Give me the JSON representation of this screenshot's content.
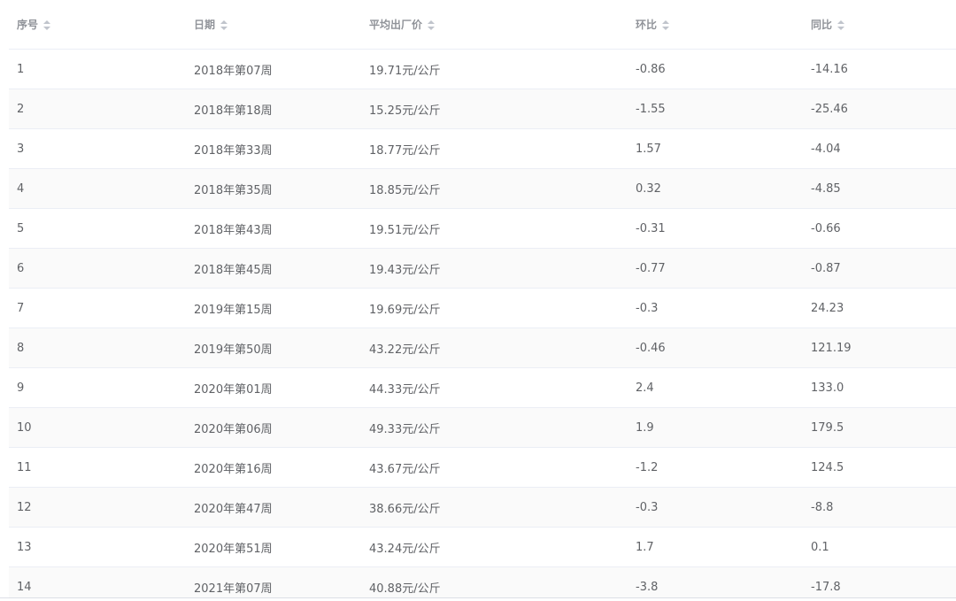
{
  "table": {
    "headers": [
      "序号",
      "日期",
      "平均出厂价",
      "环比",
      "同比"
    ],
    "rows": [
      [
        "1",
        "2018年第07周",
        "19.71元/公斤",
        "-0.86",
        "-14.16"
      ],
      [
        "2",
        "2018年第18周",
        "15.25元/公斤",
        "-1.55",
        "-25.46"
      ],
      [
        "3",
        "2018年第33周",
        "18.77元/公斤",
        "1.57",
        "-4.04"
      ],
      [
        "4",
        "2018年第35周",
        "18.85元/公斤",
        "0.32",
        "-4.85"
      ],
      [
        "5",
        "2018年第43周",
        "19.51元/公斤",
        "-0.31",
        "-0.66"
      ],
      [
        "6",
        "2018年第45周",
        "19.43元/公斤",
        "-0.77",
        "-0.87"
      ],
      [
        "7",
        "2019年第15周",
        "19.69元/公斤",
        "-0.3",
        "24.23"
      ],
      [
        "8",
        "2019年第50周",
        "43.22元/公斤",
        "-0.46",
        "121.19"
      ],
      [
        "9",
        "2020年第01周",
        "44.33元/公斤",
        "2.4",
        "133.0"
      ],
      [
        "10",
        "2020年第06周",
        "49.33元/公斤",
        "1.9",
        "179.5"
      ],
      [
        "11",
        "2020年第16周",
        "43.67元/公斤",
        "-1.2",
        "124.5"
      ],
      [
        "12",
        "2020年第47周",
        "38.66元/公斤",
        "-0.3",
        "-8.8"
      ],
      [
        "13",
        "2020年第51周",
        "43.24元/公斤",
        "1.7",
        "0.1"
      ],
      [
        "14",
        "2021年第07周",
        "40.88元/公斤",
        "-3.8",
        "-17.8"
      ]
    ]
  },
  "colors": {
    "header_text": "#909399",
    "cell_text": "#606266",
    "border": "#ebeef5",
    "striped_row": "#fafafa",
    "sort_icon": "#c0c4cc"
  }
}
